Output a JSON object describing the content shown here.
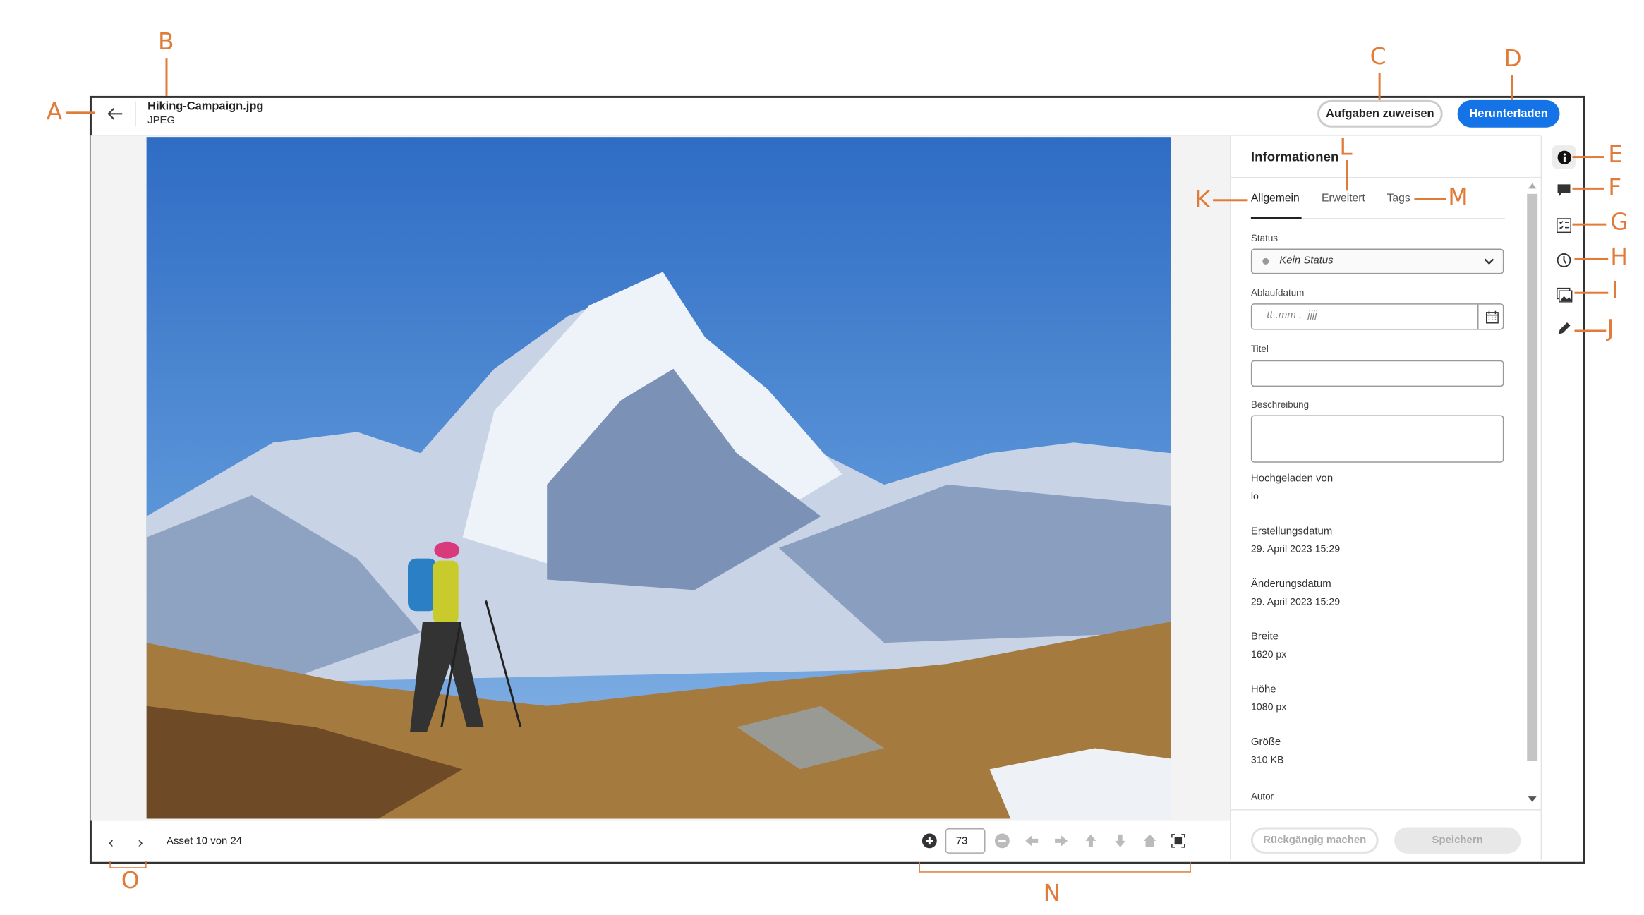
{
  "header": {
    "file_name": "Hiking-Campaign.jpg",
    "file_type": "JPEG",
    "assign_tasks_label": "Aufgaben zuweisen",
    "download_label": "Herunterladen"
  },
  "colors": {
    "accent": "#1473e6",
    "annotation": "#e07b39"
  },
  "panel": {
    "title": "Informationen",
    "tabs": [
      {
        "label": "Allgemein",
        "active": true
      },
      {
        "label": "Erweitert"
      },
      {
        "label": "Tags"
      }
    ],
    "status_label": "Status",
    "status_value": "Kein Status",
    "expiry_label": "Ablaufdatum",
    "expiry_placeholder": "tt .mm .  jjjj",
    "title_label": "Titel",
    "description_label": "Beschreibung",
    "fields": [
      {
        "label": "Hochgeladen von",
        "value": "lo"
      },
      {
        "label": "Erstellungsdatum",
        "value": "29. April 2023 15:29"
      },
      {
        "label": "Änderungsdatum",
        "value": "29. April 2023 15:29"
      },
      {
        "label": "Breite",
        "value": "1620 px"
      },
      {
        "label": "Höhe",
        "value": "1080 px"
      },
      {
        "label": "Größe",
        "value": "310 KB"
      },
      {
        "label": "Autor",
        "value": ""
      }
    ],
    "undo_label": "Rückgängig machen",
    "save_label": "Speichern"
  },
  "rail_icons": [
    "info-icon",
    "comment-icon",
    "checklist-icon",
    "clock-icon",
    "image-icon",
    "pencil-icon"
  ],
  "footer": {
    "asset_counter": "Asset 10 von 24",
    "zoom_value": "73"
  },
  "annotations": {
    "A": "A",
    "B": "B",
    "C": "C",
    "D": "D",
    "E": "E",
    "F": "F",
    "G": "G",
    "H": "H",
    "I": "I",
    "J": "J",
    "K": "K",
    "L": "L",
    "M": "M",
    "N": "N",
    "O": "O"
  }
}
